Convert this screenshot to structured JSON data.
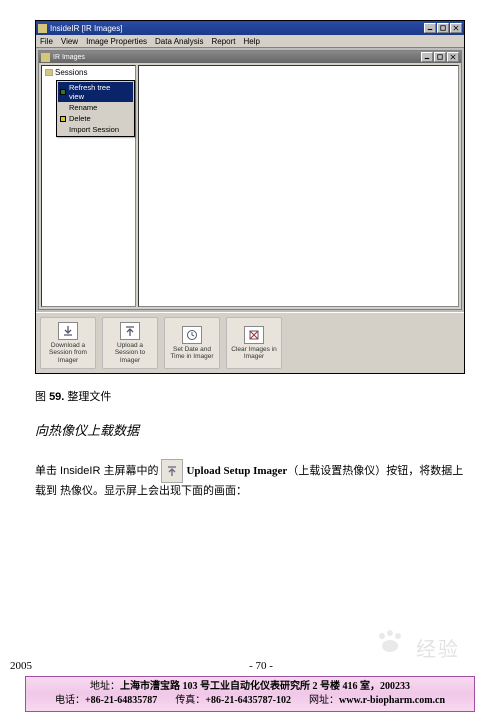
{
  "window": {
    "title": "InsideIR  [IR Images]",
    "menu": [
      "File",
      "View",
      "Image Properties",
      "Data Analysis",
      "Report",
      "Help"
    ],
    "child_title": "IR Images",
    "tree_root": "Sessions",
    "context_menu": [
      "Refresh tree view",
      "Rename",
      "Delete",
      "Import Session"
    ],
    "toolbar": [
      {
        "label": "Download a Session from Imager"
      },
      {
        "label": "Upload a Session to Imager"
      },
      {
        "label": "Set Date and Time in Imager"
      },
      {
        "label": "Clear Images in Imager"
      }
    ]
  },
  "caption_prefix": "图 ",
  "caption_num": "59.",
  "caption_text": " 整理文件",
  "subsection": "向热像仪上载数据",
  "para": {
    "p1": "单击 InsideIR 主屏幕中的",
    "btn_en": "Upload Setup Imager",
    "btn_cn": "（上载设置热像仪）按钮，将数据上",
    "p2": "载到 热像仪。显示屏上会出现下面的画面："
  },
  "footer": {
    "year": "2005",
    "page": "- 70 -",
    "right": ""
  },
  "pink": {
    "addr_label": "地址：",
    "addr": "上海市漕宝路 103 号工业自动化仪表研究所 2 号楼 416 室，200233",
    "tel_label": "电话：",
    "tel": "+86-21-64835787",
    "fax_label": "传真：",
    "fax": "+86-21-6435787-102",
    "url_label": "网址：",
    "url": "www.r-biopharm.com.cn"
  },
  "watermark": "经验"
}
